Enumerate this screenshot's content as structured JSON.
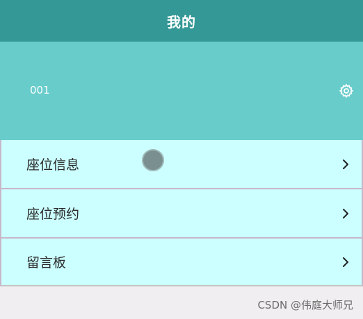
{
  "header": {
    "title": "我的"
  },
  "profile": {
    "user_id": "001",
    "settings_icon": "gear-icon"
  },
  "menu": {
    "items": [
      {
        "label": "座位信息",
        "icon": "chevron-right-icon"
      },
      {
        "label": "座位预约",
        "icon": "chevron-right-icon"
      },
      {
        "label": "留言板",
        "icon": "chevron-right-icon"
      }
    ]
  },
  "watermark": "CSDN @伟庭大师兄",
  "colors": {
    "header": "#349896",
    "profile": "#68cccb",
    "menu_item": "#ccffff",
    "background": "#f0eef0"
  }
}
